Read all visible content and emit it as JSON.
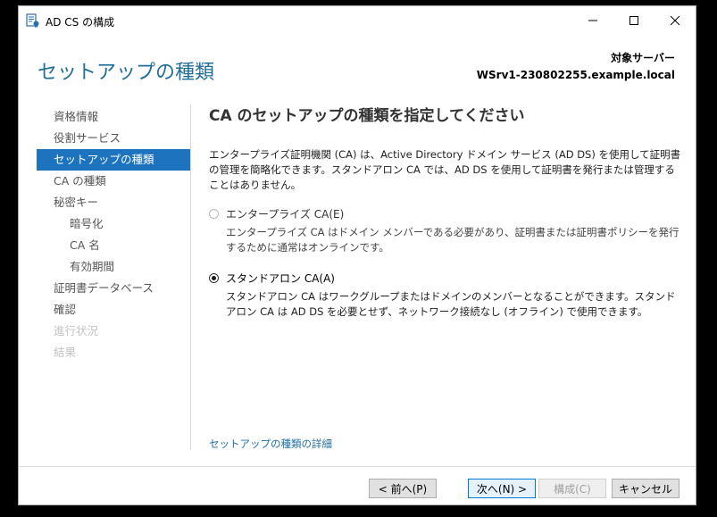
{
  "window": {
    "title": "AD CS の構成",
    "icon": "adcs-app-icon"
  },
  "header": {
    "title": "セットアップの種類",
    "server_label": "対象サーバー",
    "server_name": "WSrv1-230802255.example.local"
  },
  "nav": {
    "items": [
      {
        "label": "資格情報",
        "state": "normal"
      },
      {
        "label": "役割サービス",
        "state": "normal"
      },
      {
        "label": "セットアップの種類",
        "state": "selected"
      },
      {
        "label": "CA の種類",
        "state": "normal"
      },
      {
        "label": "秘密キー",
        "state": "normal"
      },
      {
        "label": "暗号化",
        "state": "sub"
      },
      {
        "label": "CA 名",
        "state": "sub"
      },
      {
        "label": "有効期間",
        "state": "sub"
      },
      {
        "label": "証明書データベース",
        "state": "normal"
      },
      {
        "label": "確認",
        "state": "normal"
      },
      {
        "label": "進行状況",
        "state": "disabled"
      },
      {
        "label": "結果",
        "state": "disabled"
      }
    ]
  },
  "content": {
    "title": "CA のセットアップの種類を指定してください",
    "description": "エンタープライズ証明機関 (CA) は、Active Directory ドメイン サービス (AD DS) を使用して証明書の管理を簡略化できます。スタンドアロン CA では、AD DS を使用して証明書を発行または管理することはありません。",
    "options": {
      "enterprise": {
        "label": "エンタープライズ CA(E)",
        "description": "エンタープライズ CA はドメイン メンバーである必要があり、証明書または証明書ポリシーを発行するために通常はオンラインです。",
        "selected": false,
        "enabled": false
      },
      "standalone": {
        "label": "スタンドアロン CA(A)",
        "description": "スタンドアロン CA はワークグループまたはドメインのメンバーとなることができます。スタンドアロン CA は AD DS を必要とせず、ネットワーク接続なし (オフライン) で使用できます。",
        "selected": true,
        "enabled": true
      }
    },
    "more_link": "セットアップの種類の詳細"
  },
  "footer": {
    "prev": "< 前へ(P)",
    "next": "次へ(N) >",
    "configure": "構成(C)",
    "cancel": "キャンセル"
  },
  "colors": {
    "accent": "#1e73be",
    "header_title": "#1f6e98",
    "link": "#1e6ea6"
  }
}
